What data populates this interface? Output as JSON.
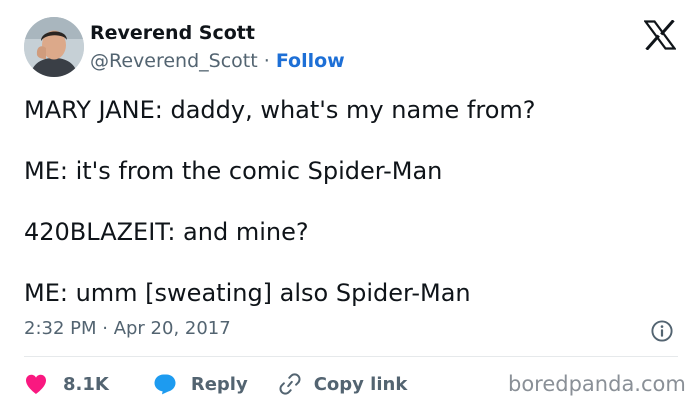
{
  "author": {
    "display_name": "Reverend Scott",
    "handle": "@Reverend_Scott",
    "separator": " · ",
    "follow_label": "Follow"
  },
  "tweet": {
    "lines": [
      "MARY JANE: daddy, what's my name from?",
      "ME: it's from the comic Spider-Man",
      "420BLAZEIT: and mine?",
      "ME: umm [sweating] also Spider-Man"
    ],
    "timestamp": "2:32 PM · Apr 20, 2017"
  },
  "actions": {
    "like_count": "8.1K",
    "reply_label": "Reply",
    "copy_link_label": "Copy link"
  },
  "watermark": "boredpanda.com",
  "colors": {
    "text": "#0f1419",
    "secondary": "#536471",
    "link": "#1d6fd6",
    "like": "#f91880",
    "reply": "#1d9bf0"
  },
  "icons": {
    "brand": "x-logo-icon",
    "info": "info-icon",
    "like": "heart-icon",
    "reply": "speech-bubble-icon",
    "copy_link": "link-icon"
  }
}
